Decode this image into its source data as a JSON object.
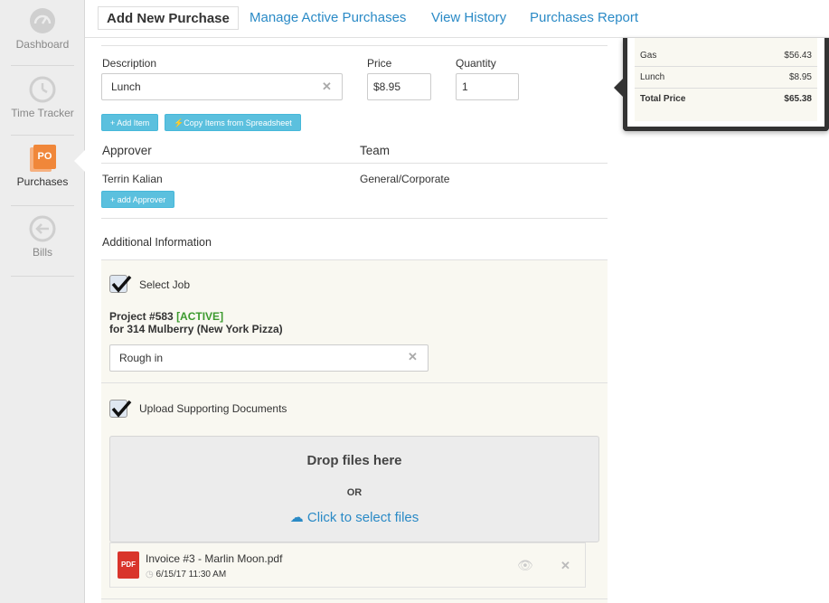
{
  "sidebar": {
    "items": [
      {
        "label": "Dashboard",
        "icon": "speedometer-icon"
      },
      {
        "label": "Time Tracker",
        "icon": "clock-icon"
      },
      {
        "label": "Purchases",
        "icon": "po-icon",
        "badge": "PO"
      },
      {
        "label": "Bills",
        "icon": "arrow-left-circle-icon"
      }
    ]
  },
  "tabs": [
    {
      "label": "Add New Purchase"
    },
    {
      "label": "Manage Active Purchases"
    },
    {
      "label": "View History"
    },
    {
      "label": "Purchases Report"
    }
  ],
  "form": {
    "description_label": "Description",
    "description_value": "Lunch",
    "price_label": "Price",
    "price_value": "$8.95",
    "quantity_label": "Quantity",
    "quantity_value": "1",
    "add_item_label": "+ Add Item",
    "copy_items_label": "Copy Items from Spreadsheet",
    "approver_heading": "Approver",
    "team_heading": "Team",
    "approver_name": "Terrin Kalian",
    "team_name": "General/Corporate",
    "add_approver_label": "+ add Approver",
    "additional_info_heading": "Additional Information"
  },
  "job": {
    "select_job_label": "Select Job",
    "select_job_checked": true,
    "project_prefix": "Project #583",
    "project_status": "[ACTIVE]",
    "project_address": "for 314 Mulberry (New York Pizza)",
    "phase_value": "Rough in"
  },
  "upload": {
    "label": "Upload Supporting Documents",
    "checked": true,
    "drop_title": "Drop files here",
    "or_text": "OR",
    "select_link": "Click to select files",
    "file_name": "Invoice #3 - Marlin Moon.pdf",
    "file_date": "6/15/17 11:30 AM",
    "file_icon_text": "PDF"
  },
  "summary": {
    "rows": [
      {
        "name": "Gas",
        "value": "$56.43"
      },
      {
        "name": "Lunch",
        "value": "$8.95"
      }
    ],
    "total_label": "Total Price",
    "total_value": "$65.38"
  },
  "colors": {
    "link": "#2a8ac6",
    "active_status": "#3c9a2e",
    "purchases_icon": "#f0873a",
    "button": "#5bc0de"
  }
}
